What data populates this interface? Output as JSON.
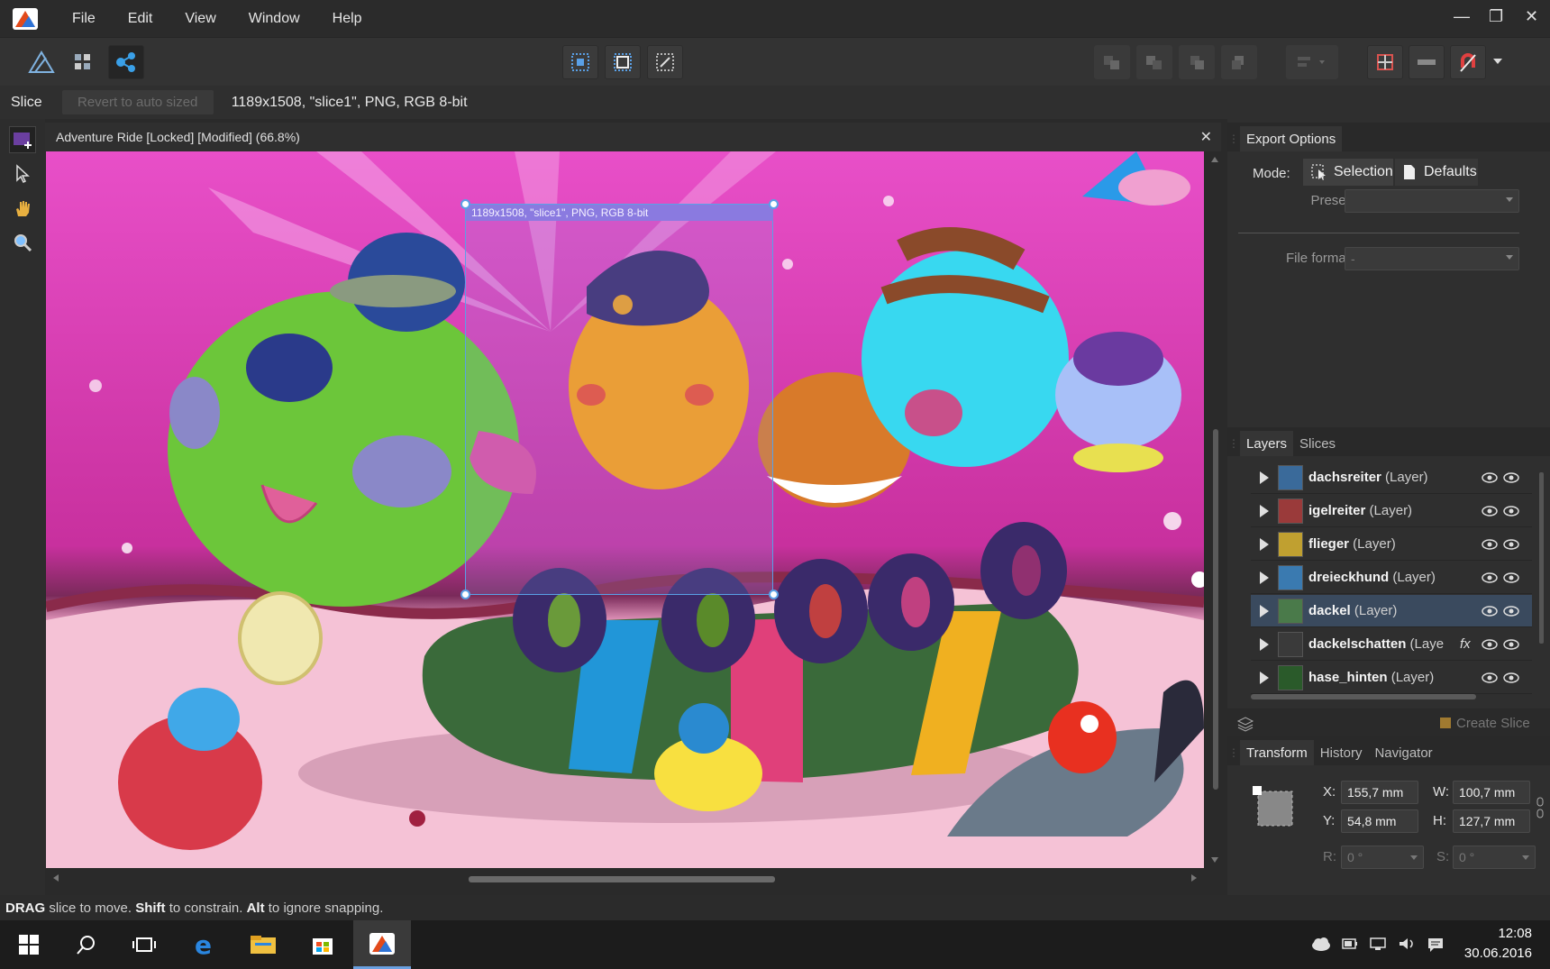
{
  "menu": {
    "items": [
      "File",
      "Edit",
      "View",
      "Window",
      "Help"
    ]
  },
  "context_bar": {
    "tool": "Slice",
    "revert_label": "Revert to auto sized",
    "info": "1189x1508, \"slice1\", PNG, RGB 8-bit"
  },
  "document": {
    "title": "Adventure Ride [Locked] [Modified] (66.8%)",
    "slice_label": "1189x1508, \"slice1\", PNG, RGB 8-bit"
  },
  "status": {
    "parts": [
      {
        "text": "DRAG",
        "bold": true
      },
      {
        "text": " slice to move. ",
        "bold": false
      },
      {
        "text": "Shift",
        "bold": true
      },
      {
        "text": " to constrain. ",
        "bold": false
      },
      {
        "text": "Alt",
        "bold": true
      },
      {
        "text": " to ignore snapping.",
        "bold": false
      }
    ]
  },
  "export_panel": {
    "tab": "Export Options",
    "mode_label": "Mode:",
    "mode_selection": "Selection",
    "mode_defaults": "Defaults",
    "preset_label": "Preset:",
    "preset_value": "",
    "format_label": "File format:",
    "format_value": "-"
  },
  "layers_panel": {
    "tabs": [
      "Layers",
      "Slices"
    ],
    "layers": [
      {
        "name": "dachsreiter",
        "type": " (Layer)",
        "fx": false,
        "selected": false
      },
      {
        "name": "igelreiter",
        "type": " (Layer)",
        "fx": false,
        "selected": false
      },
      {
        "name": "flieger",
        "type": " (Layer)",
        "fx": false,
        "selected": false
      },
      {
        "name": "dreieckhund",
        "type": " (Layer)",
        "fx": false,
        "selected": false
      },
      {
        "name": "dackel",
        "type": " (Layer)",
        "fx": false,
        "selected": true
      },
      {
        "name": "dackelschatten",
        "type": " (Laye",
        "fx": true,
        "selected": false
      },
      {
        "name": "hase_hinten",
        "type": " (Layer)",
        "fx": false,
        "selected": false
      }
    ],
    "create_slice_label": "Create Slice"
  },
  "transform_panel": {
    "tabs": [
      "Transform",
      "History",
      "Navigator"
    ],
    "x_label": "X:",
    "x_value": "155,7 mm",
    "y_label": "Y:",
    "y_value": "54,8 mm",
    "w_label": "W:",
    "w_value": "100,7 mm",
    "h_label": "H:",
    "h_value": "127,7 mm",
    "r_label": "R:",
    "r_value": "0 °",
    "s_label": "S:",
    "s_value": "0 °"
  },
  "taskbar": {
    "time": "12:08",
    "date": "30.06.2016"
  },
  "colors": {
    "accent": "#5aa0e6",
    "canvas_bg": "#e055c0",
    "selection": "#8a7ae0"
  }
}
